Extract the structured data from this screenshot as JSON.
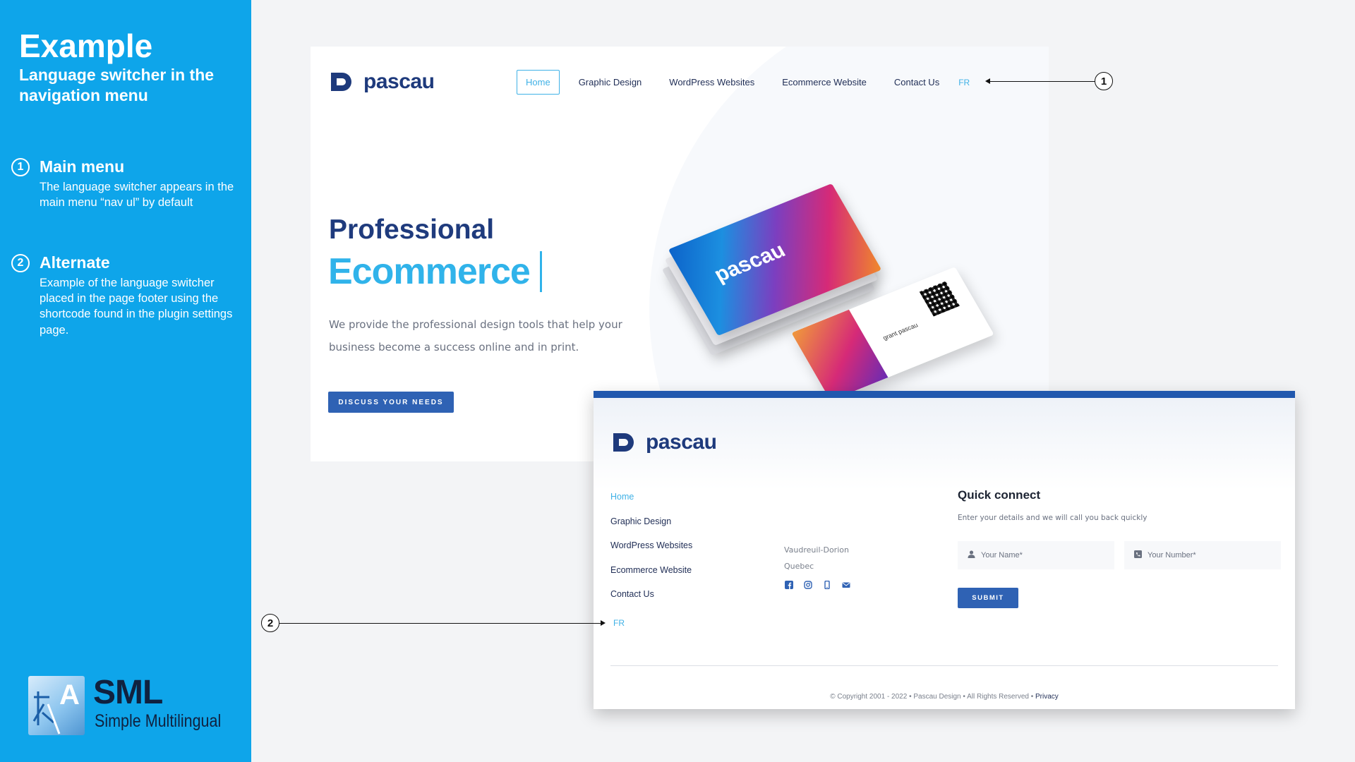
{
  "sidebar": {
    "title": "Example",
    "subtitle": "Language switcher in the navigation menu",
    "items": [
      {
        "num": "1",
        "title": "Main menu",
        "desc": "The language switcher appears in the main menu “nav ul” by default"
      },
      {
        "num": "2",
        "title": "Alternate",
        "desc": "Example of the language switcher placed in the page footer using the shortcode found in the plugin settings page."
      }
    ],
    "logo": {
      "name": "SML",
      "tagline": "Simple Multilingual",
      "icon": "sml-logo-icon"
    }
  },
  "site": {
    "brand": "pascau",
    "nav": [
      "Home",
      "Graphic Design",
      "WordPress Websites",
      "Ecommerce Website",
      "Contact Us"
    ],
    "nav_lang": "FR",
    "hero_line1": "Professional",
    "hero_line2": "Ecommerce",
    "hero_desc": "We provide the professional design tools that help your business become a success online and in print.",
    "cta": "DISCUSS YOUR NEEDS",
    "card_brand": "pascau",
    "card_name": "grant pascau"
  },
  "footer": {
    "brand": "pascau",
    "links": [
      "Home",
      "Graphic Design",
      "WordPress Websites",
      "Ecommerce Website",
      "Contact Us"
    ],
    "lang": "FR",
    "address": [
      "Vaudreuil-Dorion",
      "Quebec"
    ],
    "social_icons": [
      "facebook-icon",
      "instagram-icon",
      "phone-icon",
      "email-icon"
    ],
    "quick_connect": {
      "title": "Quick connect",
      "subtitle": "Enter your details and we will call you back quickly",
      "name_placeholder": "Your Name*",
      "number_placeholder": "Your Number*",
      "submit": "SUBMIT"
    },
    "copyright": "© Copyright 2001 - 2022 • Pascau Design • All Rights Reserved • ",
    "privacy": "Privacy"
  },
  "callouts": [
    "1",
    "2"
  ],
  "colors": {
    "sidebar_bg": "#0ea5ea",
    "brand_navy": "#1e3a7c",
    "accent_cyan": "#30b3ea",
    "button_blue": "#2f62b4"
  }
}
